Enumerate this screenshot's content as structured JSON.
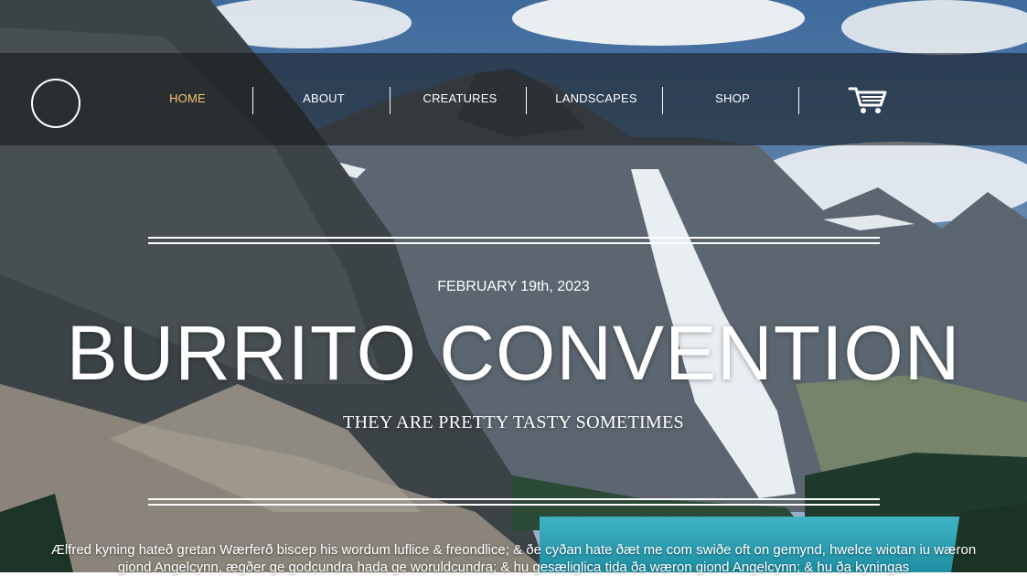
{
  "nav": {
    "logo": "logo",
    "items": [
      {
        "label": "HOME",
        "active": true
      },
      {
        "label": "ABOUT",
        "active": false
      },
      {
        "label": "CREATURES",
        "active": false
      },
      {
        "label": "LANDSCAPES",
        "active": false
      },
      {
        "label": "SHOP",
        "active": false
      }
    ],
    "cart_icon": "shopping-cart-icon"
  },
  "hero": {
    "date": "FEBRUARY 19th, 2023",
    "title": "BURRITO CONVENTION",
    "subtitle": "THEY ARE PRETTY TASTY SOMETIMES"
  },
  "article": {
    "text": "Ælfred kyning hateð gretan Wærferð biscep his wordum luflice & freondlice; & ðe cyðan hate ðæt me com swiðe oft on gemynd, hwelce wiotan iu wæron giond Angelcynn, ægðer ge godcundra hada ge woruldcundra; & hu gesæliglica tida ða wæron giond Angelcynn; & hu ða kyningas"
  },
  "colors": {
    "active_nav": "#f4c76d",
    "text": "#ffffff",
    "navbar_bg": "rgba(20,20,20,0.55)"
  }
}
